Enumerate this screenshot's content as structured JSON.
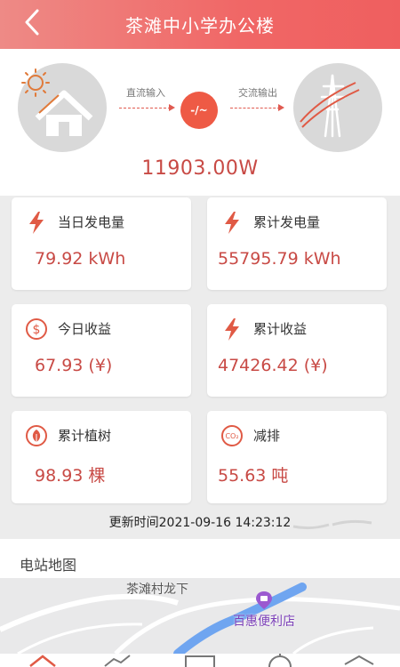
{
  "header": {
    "title": "茶滩中小学办公楼"
  },
  "flow": {
    "dc_input_label": "直流输入",
    "ac_output_label": "交流输出",
    "inverter_symbol": "-/~",
    "current_power": "11903.00W"
  },
  "cards": [
    {
      "label": "当日发电量",
      "value": "79.92 kWh",
      "icon": "lightning-icon"
    },
    {
      "label": "累计发电量",
      "value": "55795.79 kWh",
      "icon": "lightning-icon"
    },
    {
      "label": "今日收益",
      "value": "67.93 (¥)",
      "icon": "dollar-coin-icon",
      "icon_glyph": "$"
    },
    {
      "label": "累计收益",
      "value": "47426.42 (¥)",
      "icon": "lightning-icon"
    },
    {
      "label": "累计植树",
      "value": "98.93 棵",
      "icon": "leaf-icon"
    },
    {
      "label": "减排",
      "value": "55.63 吨",
      "icon": "co2-icon",
      "icon_glyph": "CO₂"
    }
  ],
  "update_time": "更新时间2021-09-16 14:23:12",
  "map": {
    "title": "电站地图",
    "place_village": "茶滩村龙下",
    "place_store": "百惠便利店"
  },
  "colors": {
    "accent": "#c84a45",
    "header_start": "#ee8a86",
    "header_end": "#ef5f5f",
    "inverter": "#ee5a45",
    "icon_red": "#e05a45",
    "map_water": "#6fa5f0"
  }
}
